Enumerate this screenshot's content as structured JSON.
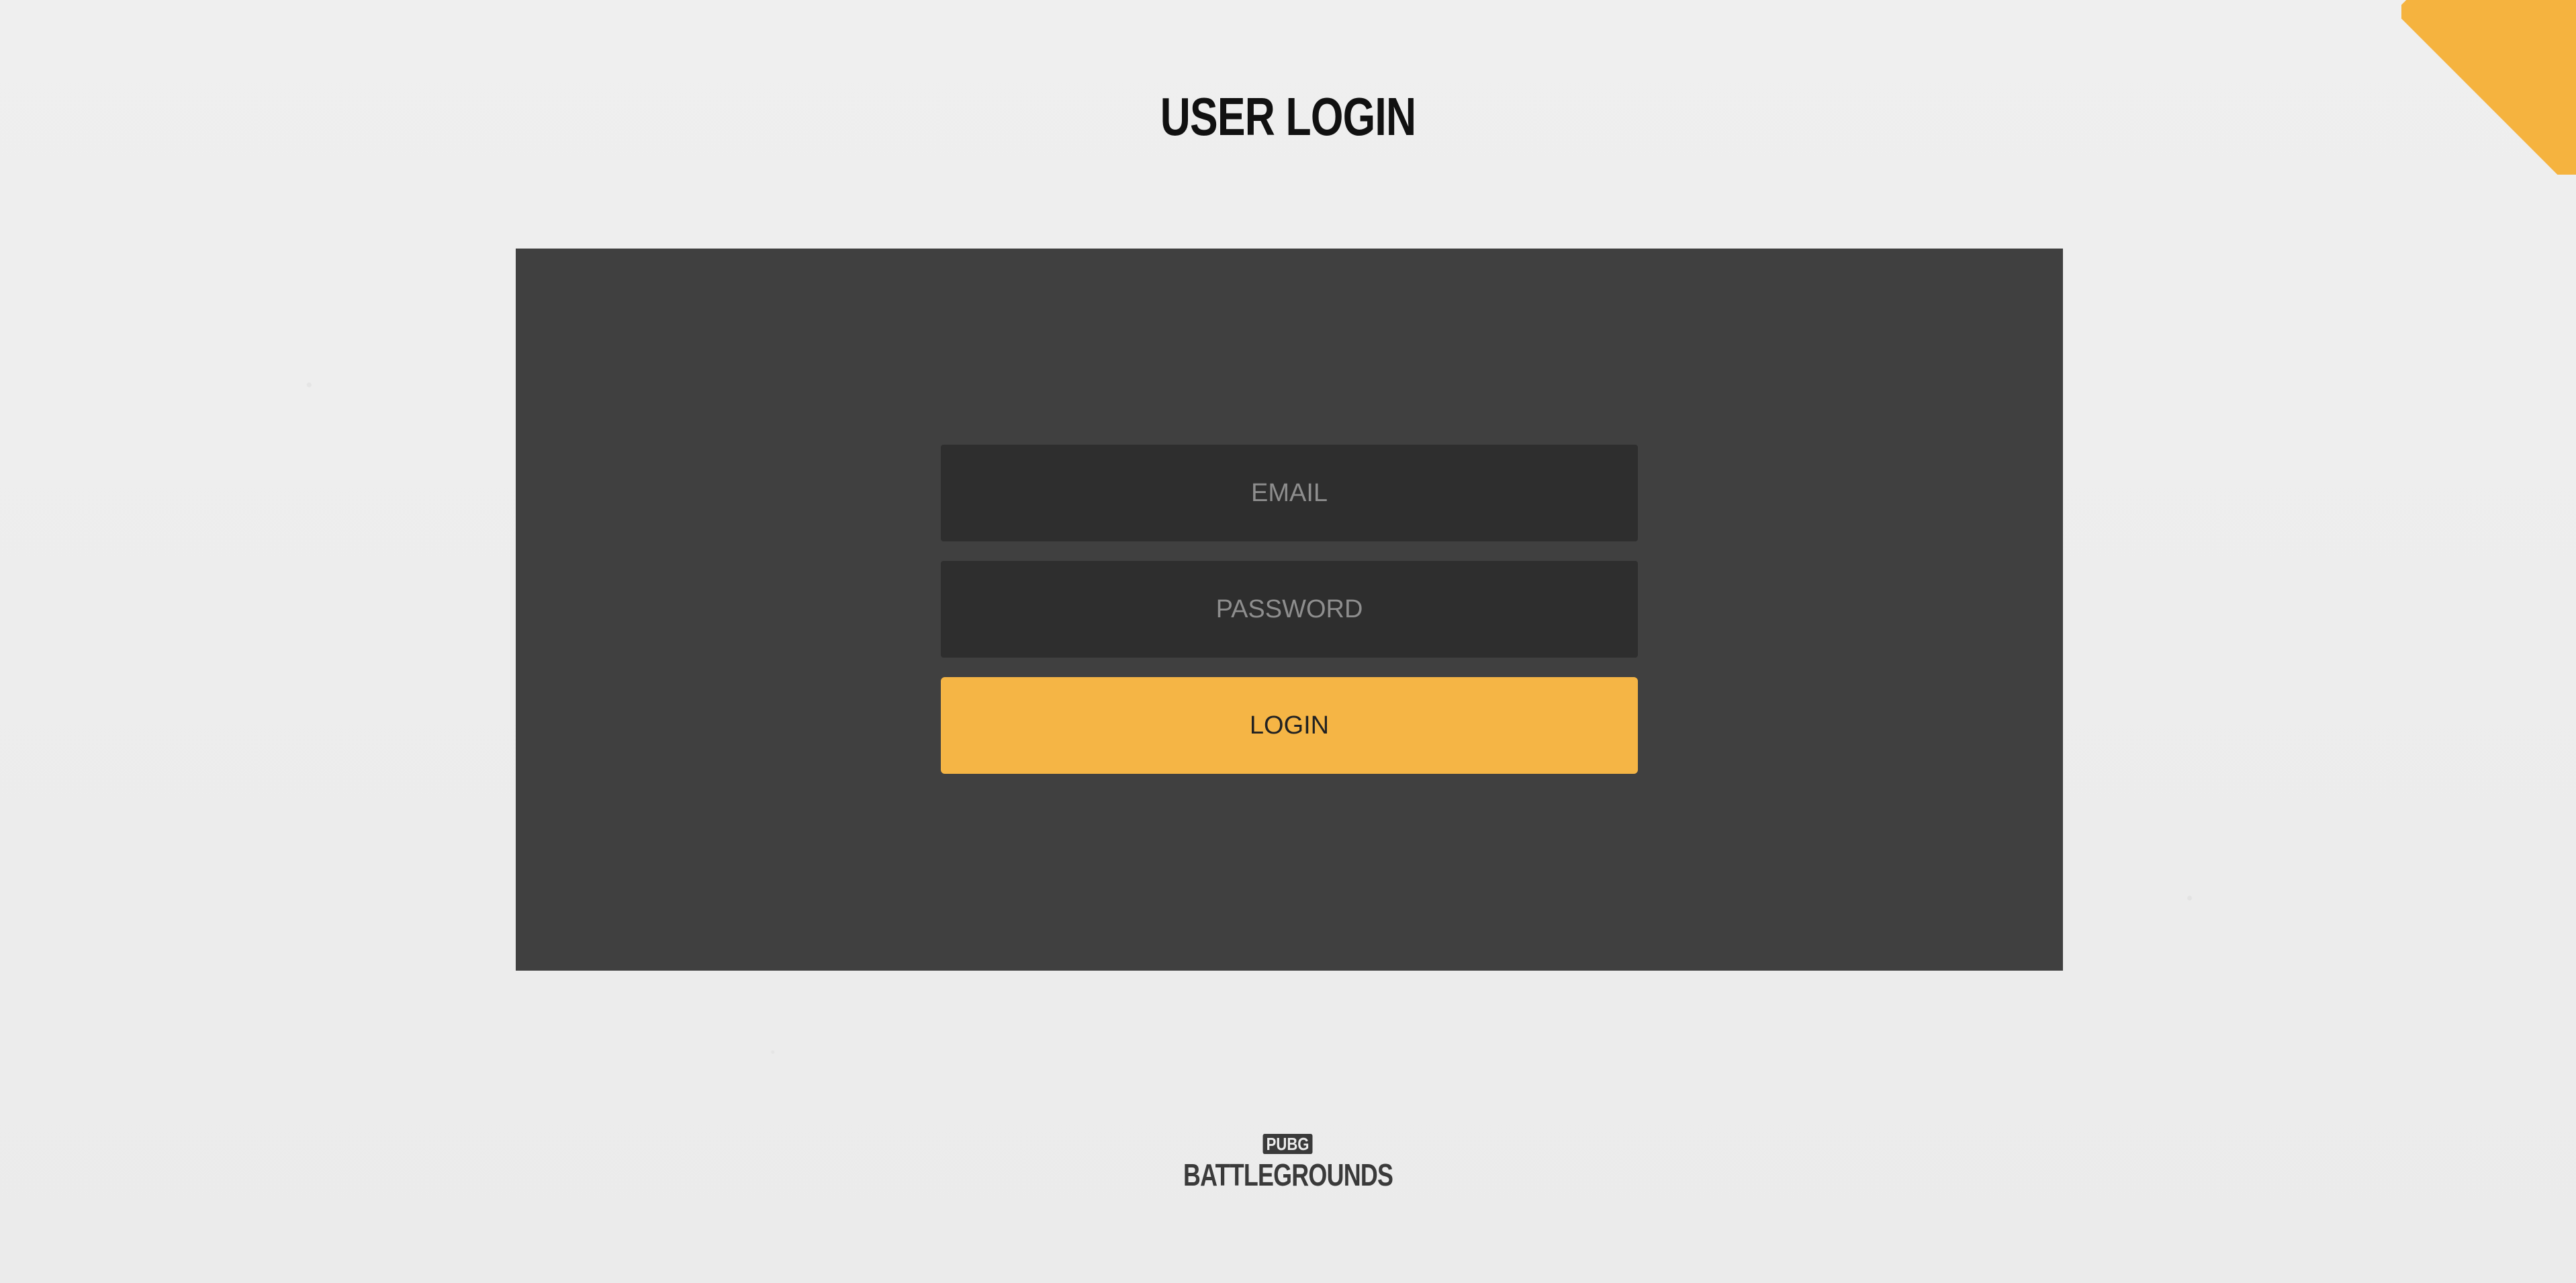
{
  "page": {
    "title": "USER LOGIN"
  },
  "form": {
    "email_placeholder": "EMAIL",
    "password_placeholder": "PASSWORD",
    "login_label": "LOGIN"
  },
  "logo": {
    "top_text": "PUBG",
    "main_text": "BATTLEGROUNDS"
  },
  "colors": {
    "background": "#ececec",
    "panel": "#404040",
    "field": "#2e2e2e",
    "accent": "#f5b545"
  }
}
